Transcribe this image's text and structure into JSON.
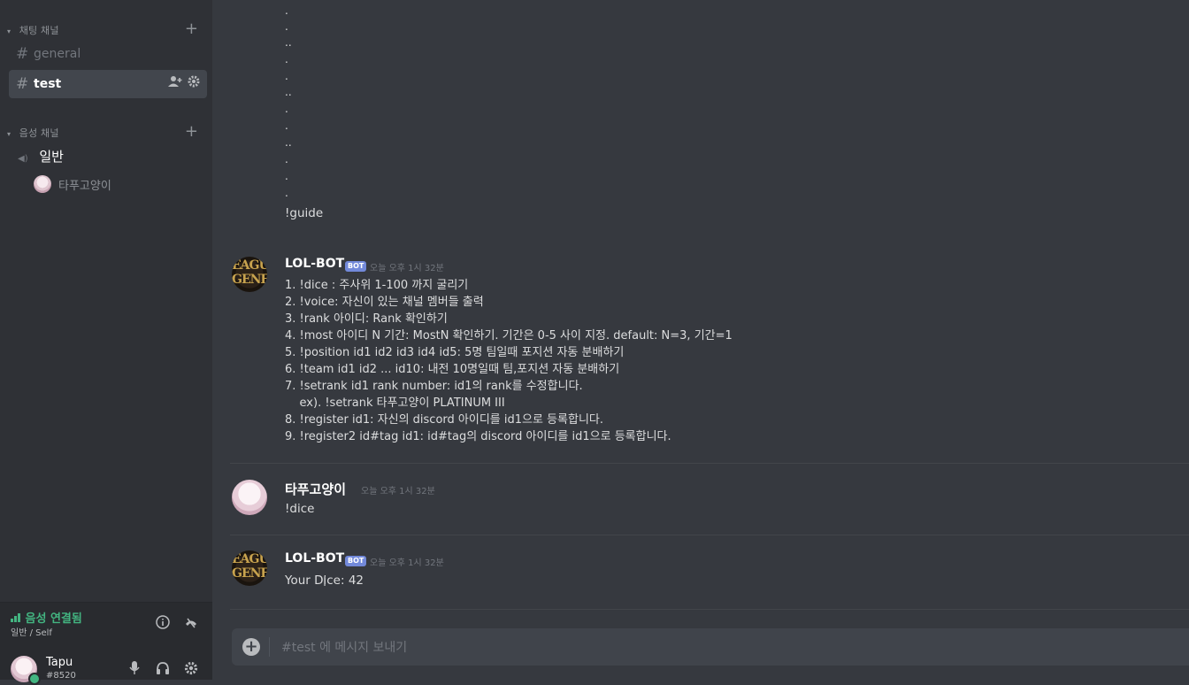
{
  "sidebar": {
    "text_category": "채팅 채널",
    "voice_category": "음성 채널",
    "channels": [
      {
        "name": "general"
      },
      {
        "name": "test"
      }
    ],
    "voice_channel": {
      "name": "일반",
      "users": [
        "타푸고양이"
      ]
    }
  },
  "voice_panel": {
    "status": "음성 연결됨",
    "sub": "일반 / Self"
  },
  "user_panel": {
    "name": "Tapu",
    "tag": "#8520"
  },
  "main": {
    "guide_text": "!guide",
    "messages": [
      {
        "author": "LOL-BOT",
        "bot_tag": "BOT",
        "timestamp": "오늘 오후 1시 32분",
        "avatar_text": "EAGU GENE",
        "lines": [
          "1. !dice : 주사위 1-100 까지 굴리기",
          "2. !voice: 자신이 있는 채널 멤버들 출력",
          "3. !rank 아이디: Rank 확인하기",
          "4. !most 아이디 N 기간: MostN 확인하기. 기간은 0-5 사이 지정. default: N=3, 기간=1",
          "5. !position id1 id2 id3 id4 id5: 5명 팀일때 포지션 자동 분배하기",
          "6. !team id1 id2 ... id10: 내전 10명일때 팀,포지션 자동 분배하기",
          "7. !setrank id1 rank number: id1의 rank를 수정합니다.",
          "    ex). !setrank 타푸고양이 PLATINUM III",
          "8. !register id1: 자신의 discord 아이디를 id1으로 등록합니다.",
          "9. !register2 id#tag id1: id#tag의 discord 아이디를 id1으로 등록합니다."
        ]
      },
      {
        "author": "타푸고양이",
        "timestamp": "오늘 오후 1시 32분",
        "text": "!dice"
      },
      {
        "author": "LOL-BOT",
        "bot_tag": "BOT",
        "timestamp": "오늘 오후 1시 32분",
        "text": "Your Dice: 42"
      }
    ]
  },
  "input": {
    "placeholder": "#test 에 메시지 보내기"
  },
  "colors": {
    "accent": "#7289da",
    "online": "#43b581",
    "background": "#36393f",
    "sidebar": "#2f3136"
  }
}
